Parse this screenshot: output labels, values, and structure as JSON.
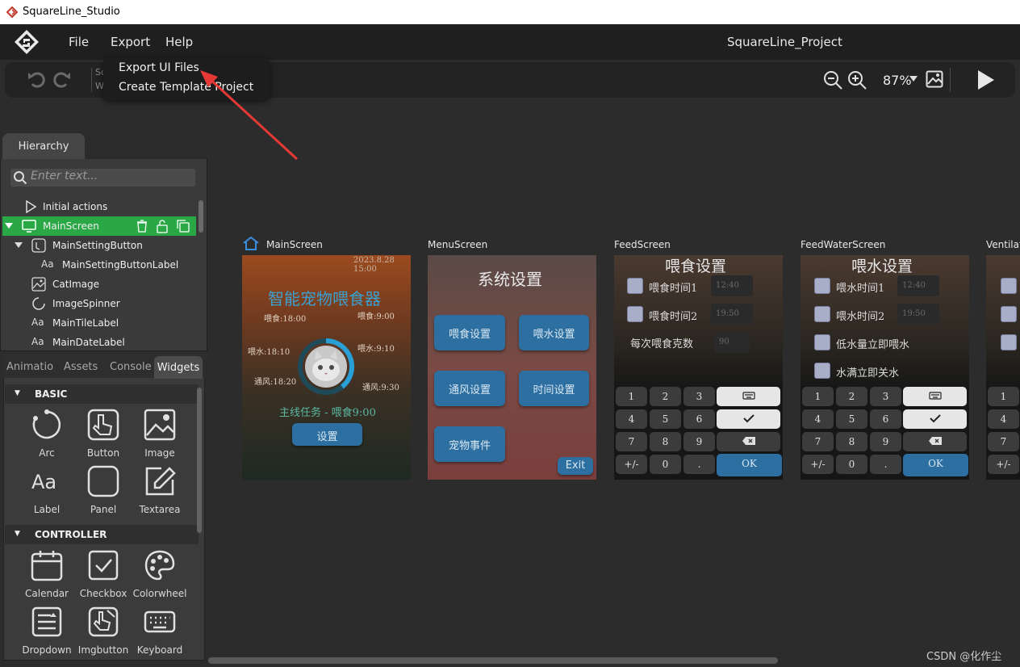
{
  "window": {
    "title": "SquareLine_Studio"
  },
  "menubar": {
    "items": [
      "File",
      "Export",
      "Help"
    ],
    "project_title": "SquareLine_Project"
  },
  "export_menu": {
    "items": [
      "Export UI Files",
      "Create Template Project"
    ]
  },
  "toolbar": {
    "zoom": "87%",
    "hidden_labels": [
      "Scre",
      "Widg"
    ]
  },
  "hierarchy": {
    "tab": "Hierarchy",
    "search_placeholder": "Enter text...",
    "items": [
      {
        "label": "Initial actions",
        "icon": "play-icon"
      },
      {
        "label": "MainScreen",
        "icon": "monitor-icon",
        "selected": true
      },
      {
        "label": "MainSettingButton",
        "icon": "button-icon"
      },
      {
        "label": "MainSettingButtonLabel",
        "icon": "label-icon"
      },
      {
        "label": "CatImage",
        "icon": "image-icon"
      },
      {
        "label": "ImageSpinner",
        "icon": "spinner-icon"
      },
      {
        "label": "MainTileLabel",
        "icon": "label-icon"
      },
      {
        "label": "MainDateLabel",
        "icon": "label-icon"
      }
    ]
  },
  "widgets_panel": {
    "tabs": [
      "Animatio",
      "Assets",
      "Console",
      "Widgets"
    ],
    "sections": [
      {
        "title": "BASIC",
        "items": [
          "Arc",
          "Button",
          "Image",
          "Label",
          "Panel",
          "Textarea"
        ]
      },
      {
        "title": "CONTROLLER",
        "items": [
          "Calendar",
          "Checkbox",
          "Colorwheel",
          "Dropdown",
          "Imgbutton",
          "Keyboard"
        ]
      }
    ]
  },
  "screens": {
    "main": {
      "name": "MainScreen",
      "date": "2023.8.28 15:00",
      "title": "智能宠物喂食器",
      "labels": [
        "喂食:18:00",
        "喂食:9:00",
        "喂水:18:10",
        "喂水:9:10",
        "通风:18:20",
        "通风:9:30"
      ],
      "task": "主线任务 - 喂食9:00",
      "button": "设置"
    },
    "menu": {
      "name": "MenuScreen",
      "title": "系统设置",
      "buttons": [
        "喂食设置",
        "喂水设置",
        "通风设置",
        "时间设置",
        "宠物事件"
      ],
      "exit": "Exit"
    },
    "feed": {
      "name": "FeedScreen",
      "title": "喂食设置",
      "rows": [
        {
          "label": "喂食时间1",
          "value": "12:40"
        },
        {
          "label": "喂食时间2",
          "value": "19:50"
        }
      ],
      "grams_label": "每次喂食克数",
      "grams_value": "90"
    },
    "water": {
      "name": "FeedWaterScreen",
      "title": "喂水设置",
      "rows": [
        {
          "label": "喂水时间1",
          "value": "12:40"
        },
        {
          "label": "喂水时间2",
          "value": "19:50"
        }
      ],
      "opt1": "低水量立即喂水",
      "opt2": "水满立即关水"
    },
    "vent": {
      "name": "Ventilat"
    },
    "keypad": [
      "1",
      "2",
      "3",
      "4",
      "5",
      "6",
      "7",
      "8",
      "9",
      "+/-",
      "0",
      ".",
      "OK"
    ]
  },
  "watermark": "CSDN @化作尘",
  "colors": {
    "accent_green": "#2aa845",
    "button_blue": "#2d6fa0",
    "arrow_red": "#e53935"
  }
}
